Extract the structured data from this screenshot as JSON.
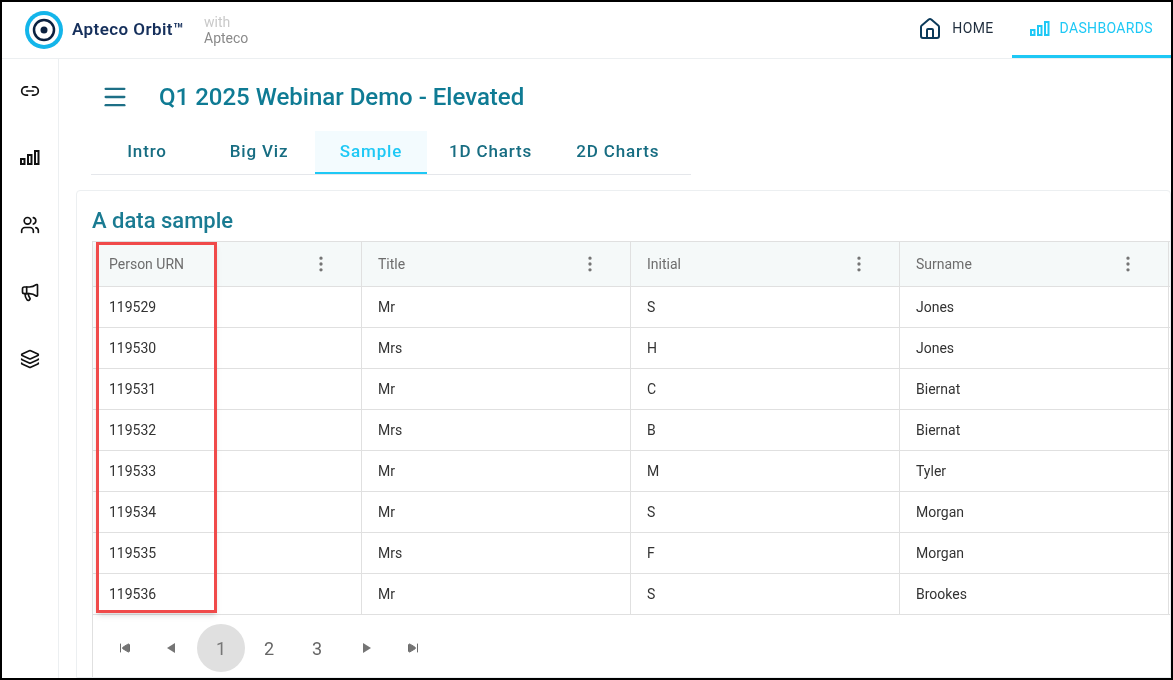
{
  "brand": {
    "name": "Apteco Orbit™",
    "with_label": "with",
    "with_name": "Apteco"
  },
  "nav": [
    {
      "label": "HOME",
      "kind": "home",
      "selected": false
    },
    {
      "label": "DASHBOARDS",
      "kind": "bars",
      "selected": true
    }
  ],
  "sidebar": {
    "items": [
      {
        "kind": "link",
        "selected": false
      },
      {
        "kind": "bars",
        "selected": false
      },
      {
        "kind": "people",
        "selected": false
      },
      {
        "kind": "megaphone",
        "selected": false
      },
      {
        "kind": "layers",
        "selected": false
      }
    ]
  },
  "dashboard": {
    "title": "Q1 2025 Webinar Demo - Elevated"
  },
  "tabs": [
    {
      "label": "Intro",
      "selected": false
    },
    {
      "label": "Big Viz",
      "selected": false
    },
    {
      "label": "Sample",
      "selected": true
    },
    {
      "label": "1D Charts",
      "selected": false
    },
    {
      "label": "2D Charts",
      "selected": false
    }
  ],
  "card": {
    "title": "A data sample"
  },
  "table": {
    "columns": [
      {
        "label": "Person URN",
        "highlighted": true
      },
      {
        "label": "Title",
        "highlighted": false
      },
      {
        "label": "Initial",
        "highlighted": false
      },
      {
        "label": "Surname",
        "highlighted": false
      }
    ],
    "rows": [
      [
        "119529",
        "Mr",
        "S",
        "Jones"
      ],
      [
        "119530",
        "Mrs",
        "H",
        "Jones"
      ],
      [
        "119531",
        "Mr",
        "C",
        "Biernat"
      ],
      [
        "119532",
        "Mrs",
        "B",
        "Biernat"
      ],
      [
        "119533",
        "Mr",
        "M",
        "Tyler"
      ],
      [
        "119534",
        "Mr",
        "S",
        "Morgan"
      ],
      [
        "119535",
        "Mrs",
        "F",
        "Morgan"
      ],
      [
        "119536",
        "Mr",
        "S",
        "Brookes"
      ]
    ]
  },
  "pager": {
    "pages": [
      {
        "label": "1",
        "selected": true
      },
      {
        "label": "2",
        "selected": false
      },
      {
        "label": "3",
        "selected": false
      }
    ]
  }
}
